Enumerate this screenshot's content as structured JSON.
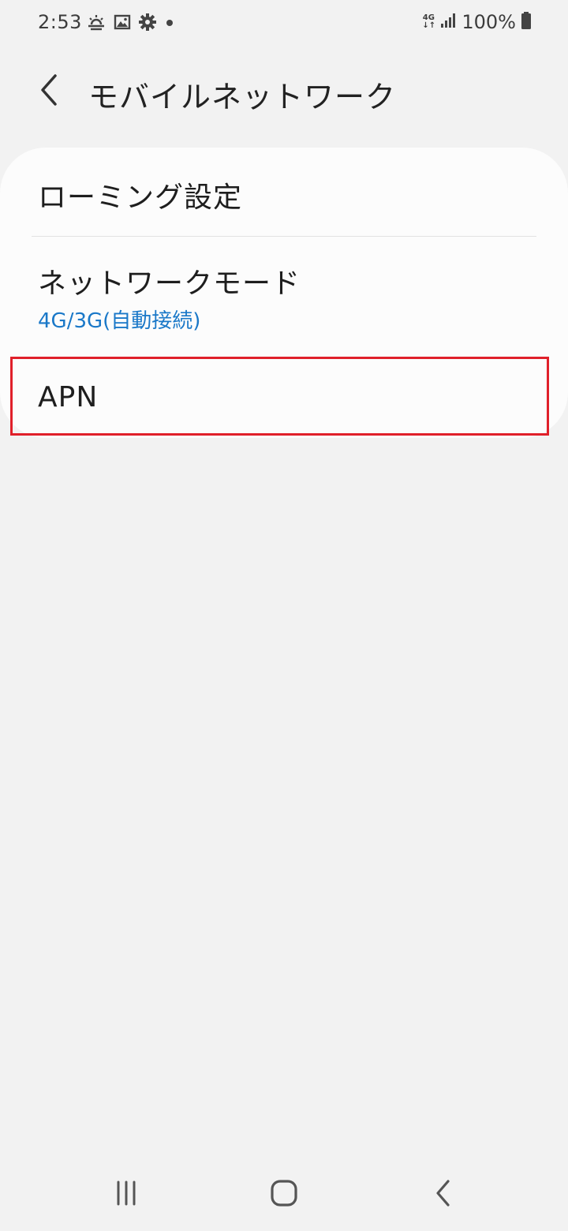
{
  "status_bar": {
    "time": "2:53",
    "left_icons": [
      "weather-icon",
      "image-icon",
      "settings-icon",
      "dot-icon"
    ],
    "network_type_top": "4G",
    "network_type_bottom": "↓↑",
    "battery_percent": "100%"
  },
  "header": {
    "back_icon": "chevron-left-icon",
    "title": "モバイルネットワーク"
  },
  "settings": {
    "items": [
      {
        "title": "ローミング設定",
        "subtitle": ""
      },
      {
        "title": "ネットワークモード",
        "subtitle": "4G/3G(自動接続)"
      },
      {
        "title": "APN",
        "subtitle": ""
      }
    ],
    "highlighted_item": "APN"
  },
  "colors": {
    "background": "#f2f2f2",
    "card": "#fcfcfc",
    "accent_blue": "#1a78c8",
    "highlight_red": "#e0202a"
  },
  "nav_bar": {
    "buttons": [
      "recent-apps-icon",
      "home-icon",
      "back-icon"
    ]
  }
}
